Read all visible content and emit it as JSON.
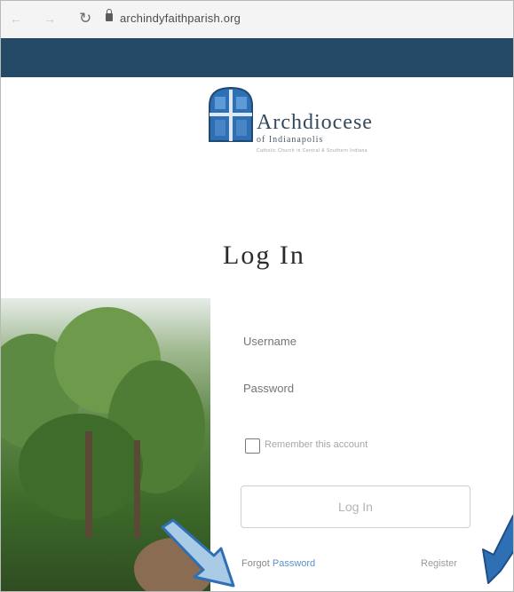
{
  "browser": {
    "url": "archindyfaithparish.org",
    "back_icon": "back-arrow-icon",
    "forward_icon": "forward-arrow-icon",
    "reload_icon": "reload-icon",
    "lock_icon": "lock-icon"
  },
  "logo": {
    "name": "Archdiocese",
    "subtitle": "of Indianapolis",
    "tagline": "Catholic Church in Central & Southern Indiana"
  },
  "login": {
    "title": "Log In",
    "username_placeholder": "Username",
    "password_placeholder": "Password",
    "remember_label": "Remember this account",
    "remember_checked": false,
    "submit_label": "Log In",
    "forgot_prefix": "Forgot",
    "forgot_link": "Password",
    "register_label": "Register"
  },
  "colors": {
    "header_band": "#254a67",
    "link_blue": "#5b8fc9",
    "arrow_fill": "#2f6fb3"
  }
}
